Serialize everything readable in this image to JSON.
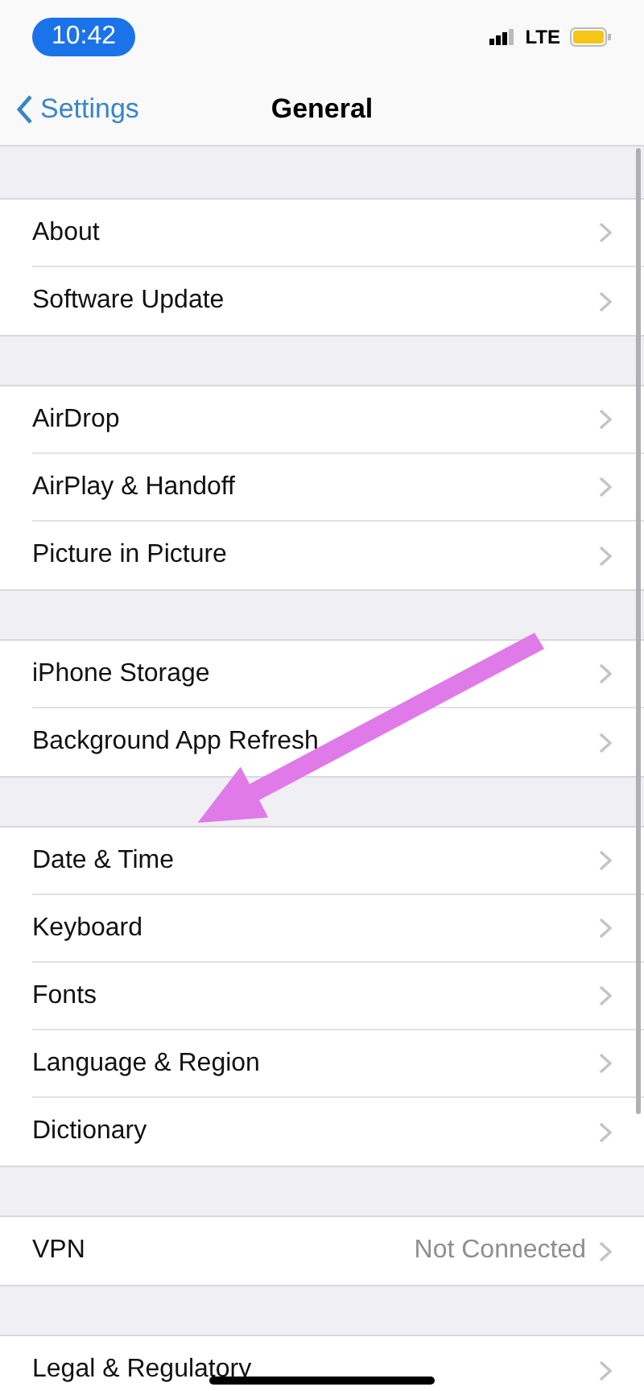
{
  "status_bar": {
    "time": "10:42",
    "network": "LTE"
  },
  "nav": {
    "back": "Settings",
    "title": "General"
  },
  "groups": [
    {
      "rows": [
        {
          "label": "About"
        },
        {
          "label": "Software Update"
        }
      ]
    },
    {
      "rows": [
        {
          "label": "AirDrop"
        },
        {
          "label": "AirPlay & Handoff"
        },
        {
          "label": "Picture in Picture"
        }
      ]
    },
    {
      "rows": [
        {
          "label": "iPhone Storage"
        },
        {
          "label": "Background App Refresh"
        }
      ]
    },
    {
      "rows": [
        {
          "label": "Date & Time"
        },
        {
          "label": "Keyboard"
        },
        {
          "label": "Fonts"
        },
        {
          "label": "Language & Region"
        },
        {
          "label": "Dictionary"
        }
      ]
    },
    {
      "rows": [
        {
          "label": "VPN",
          "value": "Not Connected"
        }
      ]
    },
    {
      "rows": [
        {
          "label": "Legal & Regulatory"
        }
      ]
    }
  ]
}
